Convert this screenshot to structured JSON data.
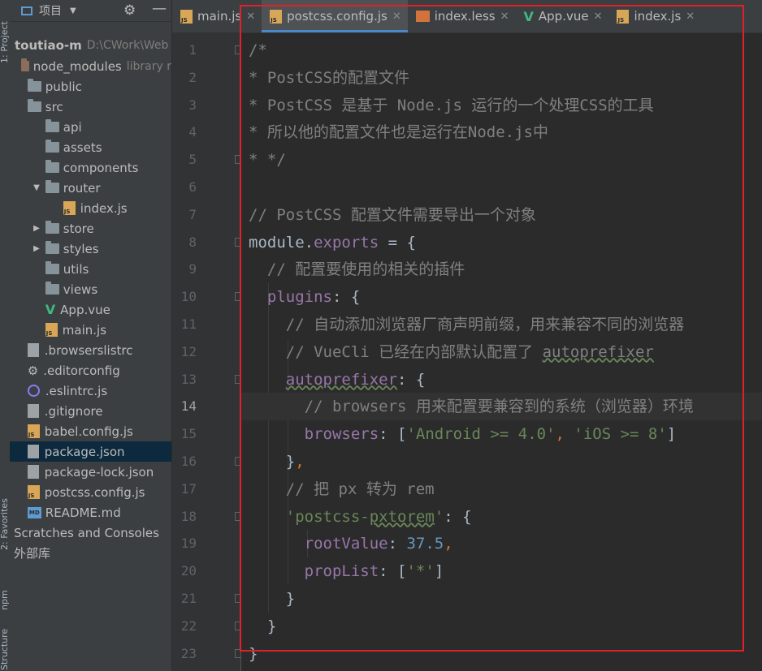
{
  "tool_strip": {
    "project_tab": "1: Project",
    "favorites_tab": "2: Favorites",
    "npm_tab": "npm",
    "structure_tab": "Structure"
  },
  "project_panel": {
    "title": "项目",
    "root_name": "toutiao-m",
    "root_path": "D:\\CWork\\Web",
    "items": [
      {
        "label": "node_modules",
        "extra": "library r",
        "icon": "folder-excluded-icon",
        "depth": 0,
        "arrow": ""
      },
      {
        "label": "public",
        "icon": "folder-icon",
        "depth": 0,
        "arrow": ""
      },
      {
        "label": "src",
        "icon": "folder-icon",
        "depth": 0,
        "arrow": ""
      },
      {
        "label": "api",
        "icon": "folder-icon",
        "depth": 1,
        "arrow": ""
      },
      {
        "label": "assets",
        "icon": "folder-icon",
        "depth": 1,
        "arrow": ""
      },
      {
        "label": "components",
        "icon": "folder-icon",
        "depth": 1,
        "arrow": ""
      },
      {
        "label": "router",
        "icon": "folder-icon",
        "depth": 1,
        "arrow": "▼"
      },
      {
        "label": "index.js",
        "icon": "js-file-icon",
        "depth": 2,
        "arrow": ""
      },
      {
        "label": "store",
        "icon": "folder-icon",
        "depth": 1,
        "arrow": "▶"
      },
      {
        "label": "styles",
        "icon": "folder-icon",
        "depth": 1,
        "arrow": "▶"
      },
      {
        "label": "utils",
        "icon": "folder-icon",
        "depth": 1,
        "arrow": ""
      },
      {
        "label": "views",
        "icon": "folder-icon",
        "depth": 1,
        "arrow": ""
      },
      {
        "label": "App.vue",
        "icon": "vue-file-icon",
        "depth": 1,
        "arrow": ""
      },
      {
        "label": "main.js",
        "icon": "js-file-icon",
        "depth": 1,
        "arrow": ""
      },
      {
        "label": ".browserslistrc",
        "icon": "config-file-icon",
        "depth": 0,
        "arrow": ""
      },
      {
        "label": ".editorconfig",
        "icon": "gear-icon",
        "depth": 0,
        "arrow": ""
      },
      {
        "label": ".eslintrc.js",
        "icon": "eslint-icon",
        "depth": 0,
        "arrow": ""
      },
      {
        "label": ".gitignore",
        "icon": "gitignore-icon",
        "depth": 0,
        "arrow": ""
      },
      {
        "label": "babel.config.js",
        "icon": "js-file-icon",
        "depth": 0,
        "arrow": ""
      },
      {
        "label": "package.json",
        "icon": "json-file-icon",
        "depth": 0,
        "arrow": "",
        "selected": true
      },
      {
        "label": "package-lock.json",
        "icon": "json-file-icon",
        "depth": 0,
        "arrow": ""
      },
      {
        "label": "postcss.config.js",
        "icon": "js-file-icon",
        "depth": 0,
        "arrow": ""
      },
      {
        "label": "README.md",
        "icon": "md-file-icon",
        "depth": 0,
        "arrow": ""
      },
      {
        "label": "Scratches and Consoles",
        "icon": "",
        "depth": -1,
        "arrow": ""
      },
      {
        "label": "外部库",
        "icon": "",
        "depth": -1,
        "arrow": ""
      }
    ]
  },
  "tabs": [
    {
      "label": "main.js",
      "icon": "js-file-icon",
      "active": false
    },
    {
      "label": "postcss.config.js",
      "icon": "js-file-icon",
      "active": true
    },
    {
      "label": "index.less",
      "icon": "less-file-icon",
      "active": false
    },
    {
      "label": "App.vue",
      "icon": "vue-file-icon",
      "active": false
    },
    {
      "label": "index.js",
      "icon": "js-file-icon",
      "active": false
    }
  ],
  "editor": {
    "current_line": 14,
    "lines": [
      [
        {
          "t": "/*",
          "c": "cm"
        }
      ],
      [
        {
          "t": "* PostCSS的配置文件",
          "c": "cm"
        }
      ],
      [
        {
          "t": "* PostCSS 是基于 Node.js 运行的一个处理CSS的工具",
          "c": "cm"
        }
      ],
      [
        {
          "t": "* 所以他的配置文件也是运行在Node.js中",
          "c": "cm"
        }
      ],
      [
        {
          "t": "* */",
          "c": "cm"
        }
      ],
      [],
      [
        {
          "t": "// PostCSS 配置文件需要导出一个对象",
          "c": "cm"
        }
      ],
      [
        {
          "t": "module",
          "c": "df"
        },
        {
          "t": ".",
          "c": "df"
        },
        {
          "t": "exports",
          "c": "pr"
        },
        {
          "t": " = {",
          "c": "df"
        }
      ],
      [
        {
          "t": "  // 配置要使用的相关的插件",
          "c": "cm"
        }
      ],
      [
        {
          "t": "  ",
          "c": "df"
        },
        {
          "t": "plugins",
          "c": "pr"
        },
        {
          "t": ": {",
          "c": "df"
        }
      ],
      [
        {
          "t": "    // 自动添加浏览器厂商声明前缀，用来兼容不同的浏览器",
          "c": "cm"
        }
      ],
      [
        {
          "t": "    // VueCli 已经在内部默认配置了 ",
          "c": "cm"
        },
        {
          "t": "autoprefixer",
          "c": "cm wavy"
        }
      ],
      [
        {
          "t": "    ",
          "c": "df"
        },
        {
          "t": "autoprefixer",
          "c": "pr wavy"
        },
        {
          "t": ": {",
          "c": "df"
        }
      ],
      [
        {
          "t": "      // browsers 用来配置要兼容到的系统（浏览器）环境",
          "c": "cm"
        }
      ],
      [
        {
          "t": "      ",
          "c": "df"
        },
        {
          "t": "browsers",
          "c": "pr"
        },
        {
          "t": ": [",
          "c": "df"
        },
        {
          "t": "'Android >= 4.0'",
          "c": "st"
        },
        {
          "t": ", ",
          "c": "kw"
        },
        {
          "t": "'iOS >= 8'",
          "c": "st"
        },
        {
          "t": "]",
          "c": "df"
        }
      ],
      [
        {
          "t": "    }",
          "c": "df"
        },
        {
          "t": ",",
          "c": "kw"
        }
      ],
      [
        {
          "t": "    // 把 px 转为 rem",
          "c": "cm"
        }
      ],
      [
        {
          "t": "    ",
          "c": "df"
        },
        {
          "t": "'postcss-",
          "c": "st"
        },
        {
          "t": "pxtorem",
          "c": "st wavy"
        },
        {
          "t": "'",
          "c": "st"
        },
        {
          "t": ": {",
          "c": "df"
        }
      ],
      [
        {
          "t": "      ",
          "c": "df"
        },
        {
          "t": "rootValue",
          "c": "pr"
        },
        {
          "t": ": ",
          "c": "df"
        },
        {
          "t": "37.5",
          "c": "nm"
        },
        {
          "t": ",",
          "c": "kw"
        }
      ],
      [
        {
          "t": "      ",
          "c": "df"
        },
        {
          "t": "propList",
          "c": "pr"
        },
        {
          "t": ": [",
          "c": "df"
        },
        {
          "t": "'*'",
          "c": "st"
        },
        {
          "t": "]",
          "c": "df"
        }
      ],
      [
        {
          "t": "    }",
          "c": "df"
        }
      ],
      [
        {
          "t": "  }",
          "c": "df"
        }
      ],
      [
        {
          "t": "}",
          "c": "df"
        }
      ]
    ]
  },
  "colors": {
    "accent": "#4a88c7",
    "highlight_box": "#e0202a",
    "selection": "#0d293e"
  }
}
